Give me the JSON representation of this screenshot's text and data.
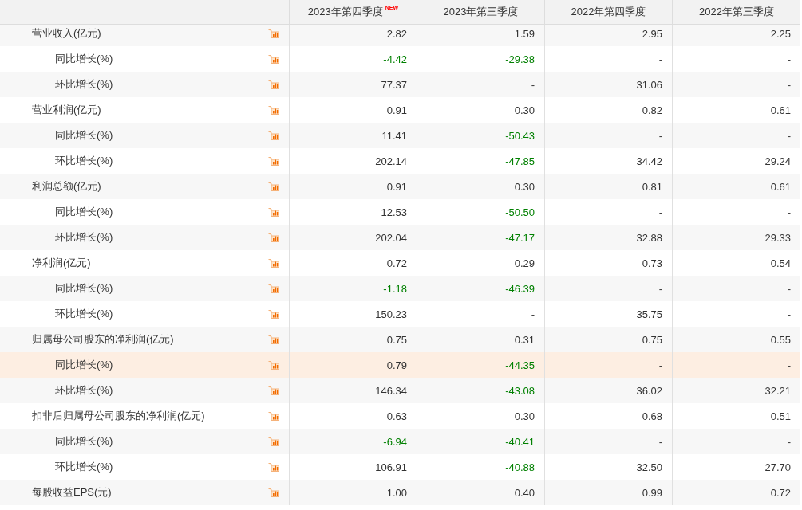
{
  "header": {
    "columns": [
      {
        "label": "2023年第四季度",
        "badge": "NEW"
      },
      {
        "label": "2023年第三季度"
      },
      {
        "label": "2022年第四季度"
      },
      {
        "label": "2022年第三季度"
      }
    ]
  },
  "metrics": [
    {
      "label": "营业收入(亿元)",
      "highlighted": false,
      "cells": [
        {
          "text": "2.82",
          "falling": false
        },
        {
          "text": "1.59",
          "falling": false
        },
        {
          "text": "2.95",
          "falling": false
        },
        {
          "text": "2.25",
          "falling": false
        }
      ],
      "children": [
        {
          "label": "同比增长(%)",
          "highlighted": false,
          "cells": [
            {
              "text": "-4.42",
              "falling": true
            },
            {
              "text": "-29.38",
              "falling": true
            },
            {
              "text": "-",
              "falling": false
            },
            {
              "text": "-",
              "falling": false
            }
          ]
        },
        {
          "label": "环比增长(%)",
          "highlighted": false,
          "cells": [
            {
              "text": "77.37",
              "falling": false
            },
            {
              "text": "-",
              "falling": false
            },
            {
              "text": "31.06",
              "falling": false
            },
            {
              "text": "-",
              "falling": false
            }
          ]
        }
      ]
    },
    {
      "label": "营业利润(亿元)",
      "highlighted": false,
      "cells": [
        {
          "text": "0.91",
          "falling": false
        },
        {
          "text": "0.30",
          "falling": false
        },
        {
          "text": "0.82",
          "falling": false
        },
        {
          "text": "0.61",
          "falling": false
        }
      ],
      "children": [
        {
          "label": "同比增长(%)",
          "highlighted": false,
          "cells": [
            {
              "text": "11.41",
              "falling": false
            },
            {
              "text": "-50.43",
              "falling": true
            },
            {
              "text": "-",
              "falling": false
            },
            {
              "text": "-",
              "falling": false
            }
          ]
        },
        {
          "label": "环比增长(%)",
          "highlighted": false,
          "cells": [
            {
              "text": "202.14",
              "falling": false
            },
            {
              "text": "-47.85",
              "falling": true
            },
            {
              "text": "34.42",
              "falling": false
            },
            {
              "text": "29.24",
              "falling": false
            }
          ]
        }
      ]
    },
    {
      "label": "利润总额(亿元)",
      "highlighted": false,
      "cells": [
        {
          "text": "0.91",
          "falling": false
        },
        {
          "text": "0.30",
          "falling": false
        },
        {
          "text": "0.81",
          "falling": false
        },
        {
          "text": "0.61",
          "falling": false
        }
      ],
      "children": [
        {
          "label": "同比增长(%)",
          "highlighted": false,
          "cells": [
            {
              "text": "12.53",
              "falling": false
            },
            {
              "text": "-50.50",
              "falling": true
            },
            {
              "text": "-",
              "falling": false
            },
            {
              "text": "-",
              "falling": false
            }
          ]
        },
        {
          "label": "环比增长(%)",
          "highlighted": false,
          "cells": [
            {
              "text": "202.04",
              "falling": false
            },
            {
              "text": "-47.17",
              "falling": true
            },
            {
              "text": "32.88",
              "falling": false
            },
            {
              "text": "29.33",
              "falling": false
            }
          ]
        }
      ]
    },
    {
      "label": "净利润(亿元)",
      "highlighted": false,
      "cells": [
        {
          "text": "0.72",
          "falling": false
        },
        {
          "text": "0.29",
          "falling": false
        },
        {
          "text": "0.73",
          "falling": false
        },
        {
          "text": "0.54",
          "falling": false
        }
      ],
      "children": [
        {
          "label": "同比增长(%)",
          "highlighted": false,
          "cells": [
            {
              "text": "-1.18",
              "falling": true
            },
            {
              "text": "-46.39",
              "falling": true
            },
            {
              "text": "-",
              "falling": false
            },
            {
              "text": "-",
              "falling": false
            }
          ]
        },
        {
          "label": "环比增长(%)",
          "highlighted": false,
          "cells": [
            {
              "text": "150.23",
              "falling": false
            },
            {
              "text": "-",
              "falling": false
            },
            {
              "text": "35.75",
              "falling": false
            },
            {
              "text": "-",
              "falling": false
            }
          ]
        }
      ]
    },
    {
      "label": "归属母公司股东的净利润(亿元)",
      "highlighted": false,
      "cells": [
        {
          "text": "0.75",
          "falling": false
        },
        {
          "text": "0.31",
          "falling": false
        },
        {
          "text": "0.75",
          "falling": false
        },
        {
          "text": "0.55",
          "falling": false
        }
      ],
      "children": [
        {
          "label": "同比增长(%)",
          "highlighted": true,
          "cells": [
            {
              "text": "0.79",
              "falling": false
            },
            {
              "text": "-44.35",
              "falling": true
            },
            {
              "text": "-",
              "falling": false
            },
            {
              "text": "-",
              "falling": false
            }
          ]
        },
        {
          "label": "环比增长(%)",
          "highlighted": false,
          "cells": [
            {
              "text": "146.34",
              "falling": false
            },
            {
              "text": "-43.08",
              "falling": true
            },
            {
              "text": "36.02",
              "falling": false
            },
            {
              "text": "32.21",
              "falling": false
            }
          ]
        }
      ]
    },
    {
      "label": "扣非后归属母公司股东的净利润(亿元)",
      "highlighted": false,
      "cells": [
        {
          "text": "0.63",
          "falling": false
        },
        {
          "text": "0.30",
          "falling": false
        },
        {
          "text": "0.68",
          "falling": false
        },
        {
          "text": "0.51",
          "falling": false
        }
      ],
      "children": [
        {
          "label": "同比增长(%)",
          "highlighted": false,
          "cells": [
            {
              "text": "-6.94",
              "falling": true
            },
            {
              "text": "-40.41",
              "falling": true
            },
            {
              "text": "-",
              "falling": false
            },
            {
              "text": "-",
              "falling": false
            }
          ]
        },
        {
          "label": "环比增长(%)",
          "highlighted": false,
          "cells": [
            {
              "text": "106.91",
              "falling": false
            },
            {
              "text": "-40.88",
              "falling": true
            },
            {
              "text": "32.50",
              "falling": false
            },
            {
              "text": "27.70",
              "falling": false
            }
          ]
        }
      ]
    },
    {
      "label": "每股收益EPS(元)",
      "highlighted": false,
      "cells": [
        {
          "text": "1.00",
          "falling": false
        },
        {
          "text": "0.40",
          "falling": false
        },
        {
          "text": "0.99",
          "falling": false
        },
        {
          "text": "0.72",
          "falling": false
        }
      ]
    }
  ]
}
